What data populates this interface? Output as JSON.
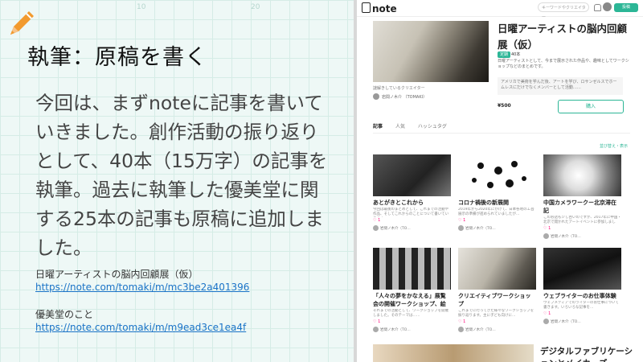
{
  "slide": {
    "title": "執筆：原稿を書く",
    "ruler_labels": [
      "10",
      "20"
    ],
    "body": "今回は、まずnoteに記事を書いていきました。創作活動の振り返りとして、40本（15万字）の記事を執筆。過去に執筆した優美堂に関する25本の記事も原稿に追加しました。",
    "refs": [
      {
        "label": "日曜アーティストの脳内回顧展（仮）",
        "url": "https://note.com/tomaki/m/mc3be2a401396"
      },
      {
        "label": "優美堂のこと",
        "url": "https://note.com/tomaki/m/m9ead3ce1ea4f"
      }
    ],
    "colors": {
      "accent": "#f29a2e",
      "link": "#1a73c7",
      "background": "#eef8f6"
    }
  },
  "note": {
    "logo": "note",
    "search_placeholder": "キーワードやクリエイター",
    "post_label": "投稿",
    "caption": "謎解きしているクリエイター",
    "author": "岩間ノ木介 （TOMAKI）",
    "magazine": {
      "title": "日曜アーティストの脳内回顧展（仮）",
      "tag": "定期",
      "count": "40本",
      "description": "日曜アーティストとして、今まで展示された作品や、趣味としてワークショップなどのまとめです。",
      "note_box": "アメリカで美術を学んだ後、アートを学び、ロサンゼルスでホームレスにだけでなくメンバーとして活動……",
      "price": "¥500",
      "buy_label": "購入"
    },
    "tabs": [
      {
        "label": "記事",
        "active": true
      },
      {
        "label": "人気",
        "active": false
      },
      {
        "label": "ハッシュタグ",
        "active": false
      }
    ],
    "sort_label": "並び替え・表示",
    "cards": [
      {
        "title": "あとがきとこれから",
        "excerpt": "今回は最後のまとめとして、これまでの活動や作品、そしてこれからのことについて書いていきます…",
        "likes": "1",
        "author": "岩間ノ木介（TO…"
      },
      {
        "title": "コロナ禍後の新展開",
        "excerpt": "2019年から2020年にかけて、日本各地の工芸展示の準備が進められていましたが…",
        "likes": "1",
        "author": "岩間ノ木介（TO…"
      },
      {
        "title": "中国カメラワークー北京滞在記",
        "excerpt": "このお話も少し古いのですが、2017年に中国・北京で開かれたアートイベントに参加しました…",
        "likes": "1",
        "author": "岩間ノ木介（TO…"
      },
      {
        "title": "「人々の夢をかなえる」展覧会の開催ワークショップ、絵を描く",
        "excerpt": "それまでの活動として、ワークショップを開催しました。そのテーマは……",
        "likes": "1",
        "author": "岩間ノ木介（TO…"
      },
      {
        "title": "クリエイティブワークショップ",
        "excerpt": "これまでに行ってきた様々なワークショップを振り返ります。主に子ども向けに…",
        "likes": "1",
        "author": "岩間ノ木介（TO…"
      },
      {
        "title": "ウェブライターのお仕事体験",
        "excerpt": "ウェブメディアでのライターのお仕事について書きます。いろいろな記事を…",
        "likes": "1",
        "author": "岩間ノ木介（TO…"
      }
    ],
    "bottom_title": "デジタルファブリケーションとメイカーズ"
  }
}
